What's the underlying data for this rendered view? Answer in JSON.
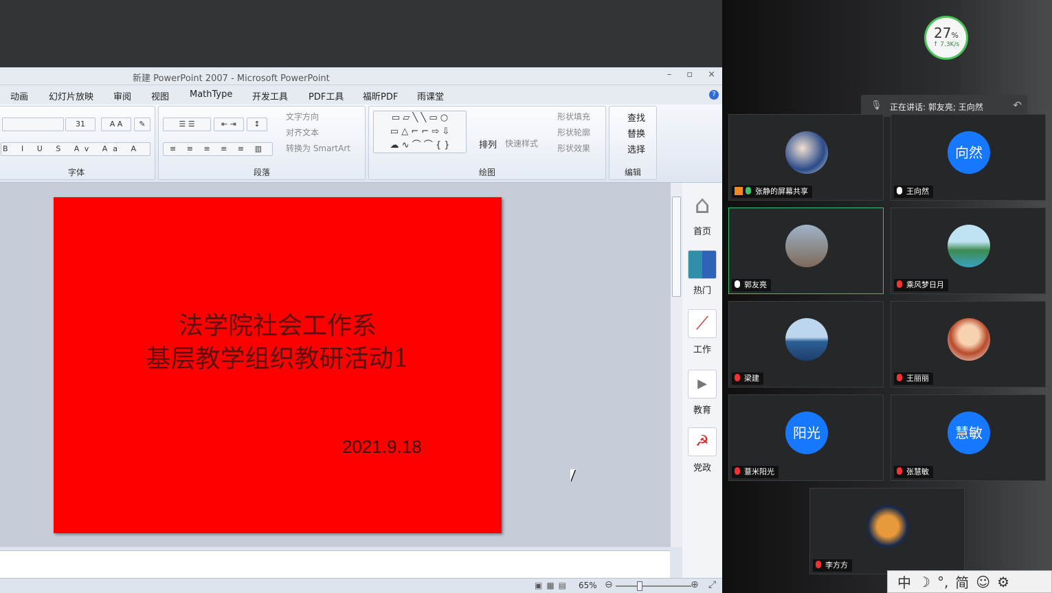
{
  "ppt": {
    "window_title": "新建 PowerPoint 2007 - Microsoft PowerPoint",
    "window_controls": [
      "–",
      "▫",
      "×"
    ],
    "menu": [
      "动画",
      "幻灯片放映",
      "审阅",
      "视图",
      "MathType",
      "开发工具",
      "PDF工具",
      "福昕PDF",
      "雨课堂"
    ],
    "ribbon": {
      "font_size": "31",
      "font_group": "字体",
      "paragraph_group": "段落",
      "drawing_group": "绘图",
      "edit_group": "编辑",
      "text_direction": "文字方向",
      "align_text": "对齐文本",
      "smartart": "转换为 SmartArt",
      "arrange": "排列",
      "quick_styles": "快速样式",
      "shape_fill": "形状填充",
      "shape_outline": "形状轮廓",
      "shape_effects": "形状效果",
      "find": "查找",
      "replace": "替换",
      "select": "选择"
    },
    "slide": {
      "line1": "法学院社会工作系",
      "line2": "基层教学组织教研活动1",
      "date": "2021.9.18"
    },
    "zoom": "65%",
    "side_panel": [
      "首页",
      "热门",
      "工作",
      "教育",
      "党政"
    ]
  },
  "meeting": {
    "network": {
      "percent": "27",
      "unit": "%",
      "speed": "↑ 7.3K/s"
    },
    "speaking": "正在讲话: 郭友亮; 王向然",
    "participants": [
      {
        "name": "张静的屏幕共享",
        "avatar_text": "",
        "mic": "on"
      },
      {
        "name": "王向然",
        "avatar_text": "向然",
        "mic": "on"
      },
      {
        "name": "郭友亮",
        "avatar_text": "",
        "mic": "on"
      },
      {
        "name": "乘风梦日月",
        "avatar_text": "",
        "mic": "off"
      },
      {
        "name": "梁建",
        "avatar_text": "",
        "mic": "off"
      },
      {
        "name": "王丽丽",
        "avatar_text": "",
        "mic": "off"
      },
      {
        "name": "薏米阳光",
        "avatar_text": "阳光",
        "mic": "off"
      },
      {
        "name": "张慧敏",
        "avatar_text": "慧敏",
        "mic": "off"
      },
      {
        "name": "李方方",
        "avatar_text": "",
        "mic": "off"
      }
    ]
  },
  "ime": [
    "中",
    "☽",
    "°,",
    "简",
    "☺",
    "⚙"
  ]
}
